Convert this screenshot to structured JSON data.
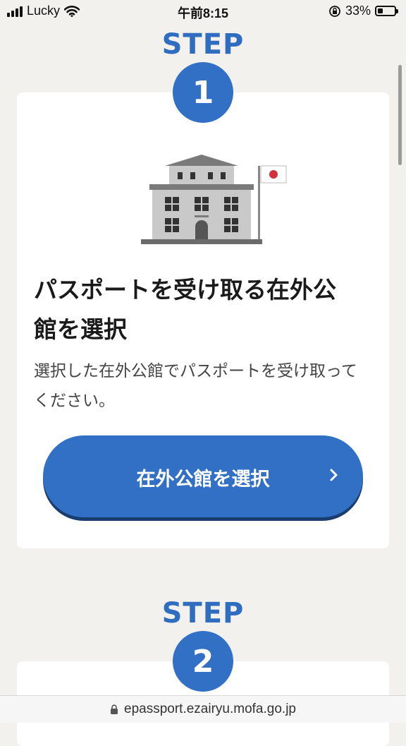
{
  "status_bar": {
    "carrier": "Lucky",
    "time": "午前8:15",
    "battery_percent": "33%",
    "battery_level": 0.33
  },
  "steps": [
    {
      "label": "STEP",
      "number": "1"
    },
    {
      "label": "STEP",
      "number": "2"
    }
  ],
  "card1": {
    "title": "パスポートを受け取る在外公館を選択",
    "description": "選択した在外公館でパスポートを受け取ってください。",
    "button_label": "在外公館を選択"
  },
  "url_bar": {
    "url": "epassport.ezairyu.mofa.go.jp"
  },
  "colors": {
    "accent": "#3270c6",
    "step_text": "#2f6dc1",
    "background": "#f2f1ee"
  }
}
